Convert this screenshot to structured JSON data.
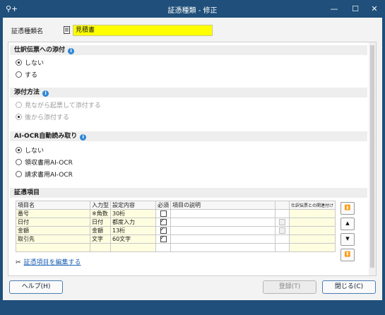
{
  "window": {
    "title": "証憑種類 - 修正",
    "minimize": "—",
    "maximize": "☐",
    "close": "✕",
    "app_icon": "key-plus-icon"
  },
  "doc_kind": {
    "label": "証憑種類名",
    "value": "見積書",
    "icon": "document-icon"
  },
  "sections": {
    "attach": {
      "title": "仕訳伝票への添付",
      "options": [
        {
          "label": "しない",
          "selected": true
        },
        {
          "label": "する",
          "selected": false
        }
      ]
    },
    "method": {
      "title": "添付方法",
      "options": [
        {
          "label": "見ながら起票して添付する",
          "selected": false
        },
        {
          "label": "後から添付する",
          "selected": true
        }
      ]
    },
    "ocr": {
      "title": "AI-OCR自動読み取り",
      "options": [
        {
          "label": "しない",
          "selected": true
        },
        {
          "label": "領収書用AI-OCR",
          "selected": false
        },
        {
          "label": "請求書用AI-OCR",
          "selected": false
        }
      ]
    },
    "items": {
      "title": "証憑項目"
    }
  },
  "table": {
    "headers": [
      "項目名",
      "入力型",
      "設定内容",
      "必須",
      "項目の説明",
      "",
      "仕訳伝票との関連付け"
    ],
    "rows": [
      {
        "name": "番号",
        "type": "※角数",
        "setting": "30桁",
        "required": false,
        "desc": ""
      },
      {
        "name": "日付",
        "type": "日付",
        "setting": "都度入力",
        "required": true,
        "desc": ""
      },
      {
        "name": "金額",
        "type": "金額",
        "setting": "13桁",
        "required": true,
        "desc": ""
      },
      {
        "name": "取引先",
        "type": "文字",
        "setting": "60文字",
        "required": true,
        "desc": ""
      }
    ]
  },
  "side_buttons": [
    "top",
    "up",
    "down",
    "bottom"
  ],
  "edit_link": {
    "icon": "tools-icon",
    "label": "証憑項目を編集する"
  },
  "buttons": {
    "help": "ヘルプ(H)",
    "register": "登録(T)",
    "close": "閉じる(C)"
  },
  "colors": {
    "titlebar": "#1f4f7a",
    "highlight": "#ffff00",
    "info": "#2f87d4",
    "link": "#1a5fb4"
  }
}
